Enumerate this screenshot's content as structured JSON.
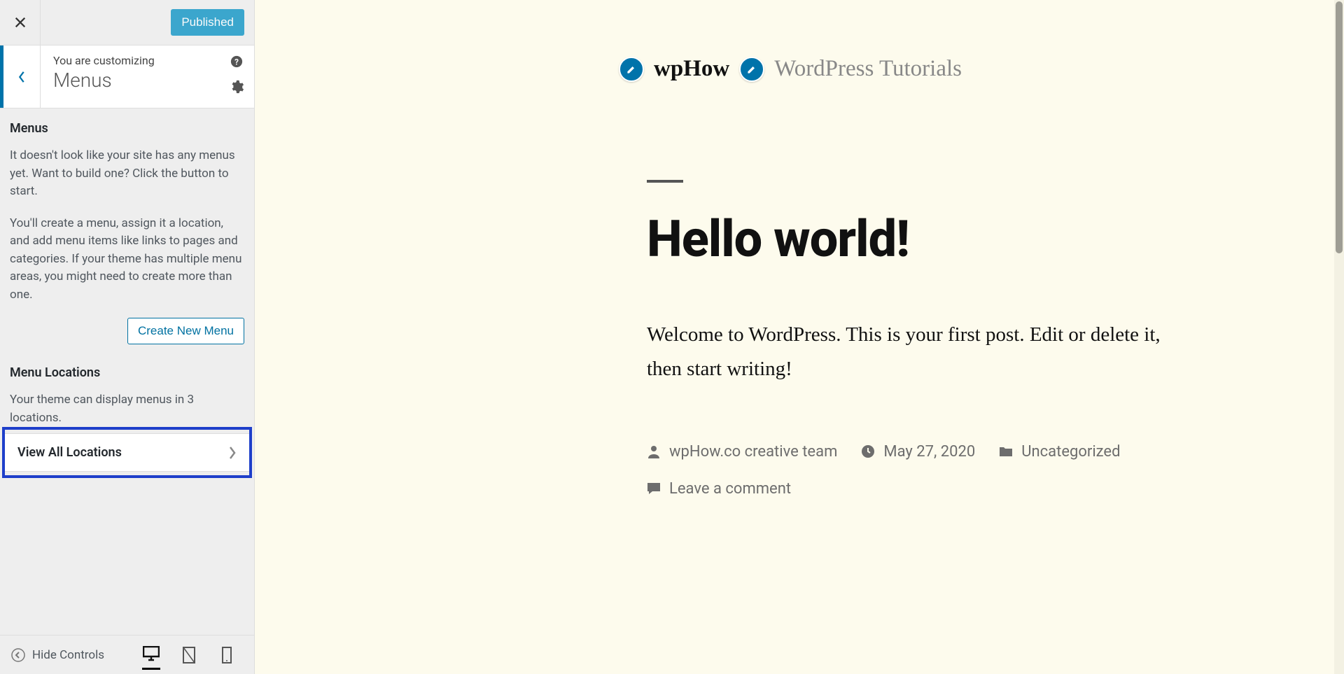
{
  "sidebar": {
    "published_label": "Published",
    "customizing_label": "You are customizing",
    "section_title": "Menus",
    "menus_heading": "Menus",
    "para1": "It doesn't look like your site has any menus yet. Want to build one? Click the button to start.",
    "para2": "You'll create a menu, assign it a location, and add menu items like links to pages and categories. If your theme has multiple menu areas, you might need to create more than one.",
    "create_label": "Create New Menu",
    "locations_heading": "Menu Locations",
    "locations_text": "Your theme can display menus in 3 locations.",
    "view_all_label": "View All Locations",
    "hide_controls_label": "Hide Controls"
  },
  "preview": {
    "site_title": "wpHow",
    "site_tagline": "WordPress Tutorials",
    "post_title": "Hello world!",
    "post_body": "Welcome to WordPress. This is your first post. Edit or delete it, then start writing!",
    "author": "wpHow.co creative team",
    "date": "May 27, 2020",
    "category": "Uncategorized",
    "comment_link": "Leave a comment"
  }
}
